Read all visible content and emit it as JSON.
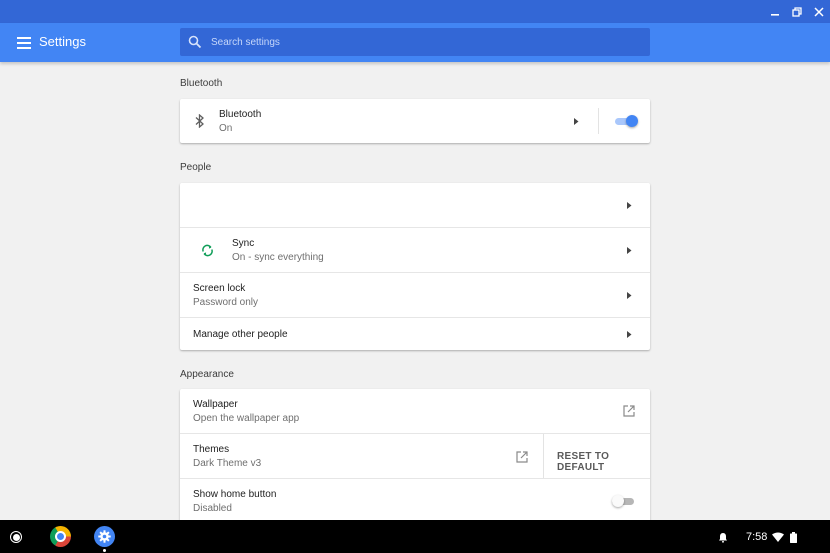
{
  "window": {
    "minimize_icon": "minimize-icon",
    "maximize_icon": "restore-icon",
    "close_icon": "close-icon"
  },
  "toolbar": {
    "title": "Settings",
    "menu_icon": "hamburger-menu-icon",
    "search": {
      "placeholder": "Search settings",
      "value": ""
    }
  },
  "sections": {
    "bluetooth": {
      "title": "Bluetooth",
      "row": {
        "label": "Bluetooth",
        "sublabel": "On",
        "icon": "bluetooth-icon",
        "enabled": true
      }
    },
    "people": {
      "title": "People",
      "sync": {
        "label": "Sync",
        "sublabel": "On - sync everything",
        "icon": "sync-icon"
      },
      "screen_lock": {
        "label": "Screen lock",
        "sublabel": "Password only"
      },
      "manage_people": {
        "label": "Manage other people"
      }
    },
    "appearance": {
      "title": "Appearance",
      "wallpaper": {
        "label": "Wallpaper",
        "sublabel": "Open the wallpaper app",
        "icon": "open-external-icon"
      },
      "themes": {
        "label": "Themes",
        "sublabel": "Dark Theme v3",
        "icon": "open-external-icon",
        "reset_label": "RESET TO DEFAULT"
      },
      "home_button": {
        "label": "Show home button",
        "sublabel": "Disabled",
        "enabled": false
      }
    }
  },
  "shelf": {
    "clock": "7:58",
    "apps": [
      "chrome-icon",
      "settings-gear-icon"
    ],
    "tray": [
      "notification-bell-icon",
      "wifi-icon",
      "battery-icon"
    ]
  },
  "colors": {
    "titlebar": "#3367d6",
    "toolbar": "#4285f4",
    "toggle_on": "#4285f4",
    "sync_green": "#0f9d58"
  }
}
